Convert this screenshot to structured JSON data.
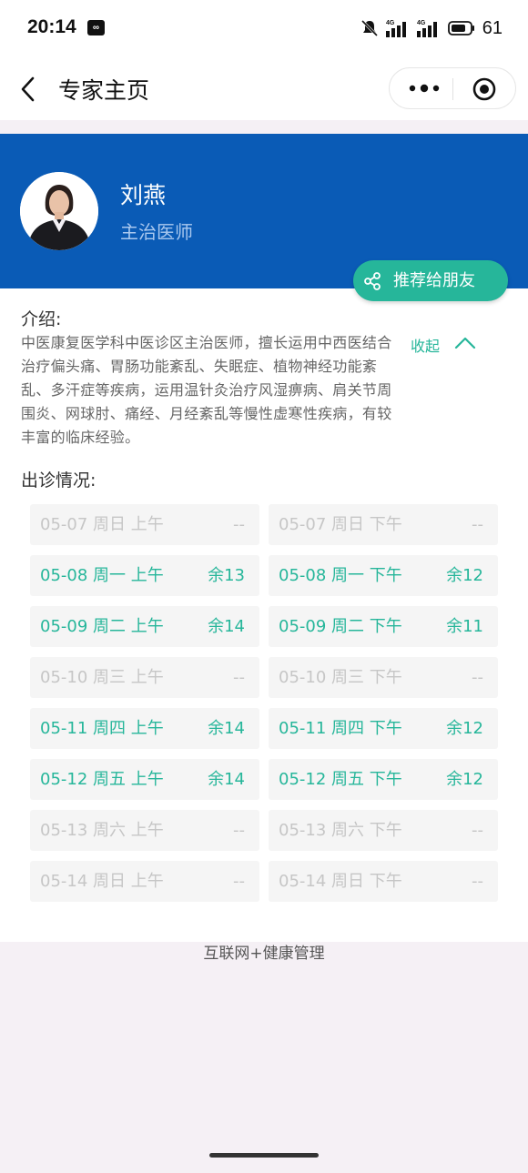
{
  "status_bar": {
    "time": "20:14",
    "battery": "61",
    "icons": [
      "app-notification-icon",
      "mute-icon",
      "signal-4g-icon",
      "signal-4g-icon",
      "battery-icon"
    ]
  },
  "nav": {
    "back_icon": "back-chevron-icon",
    "title": "专家主页",
    "capsule_icons": [
      "more-dots-icon",
      "target-icon"
    ]
  },
  "doctor": {
    "name": "刘燕",
    "title": "主治医师"
  },
  "share": {
    "label": "推荐给朋友",
    "icon": "share-icon"
  },
  "intro": {
    "label": "介绍:",
    "text": "中医康复医学科中医诊区主治医师，擅长运用中西医结合治疗偏头痛、胃肠功能紊乱、失眠症、植物神经功能紊乱、多汗症等疾病，运用温针灸治疗风湿痹病、肩关节周围炎、网球肘、痛经、月经紊乱等慢性虚寒性疾病，有较丰富的临床经验。",
    "collapse_label": "收起"
  },
  "schedule": {
    "label": "出诊情况:",
    "rows": [
      {
        "am": {
          "date": "05-07 周日 上午",
          "avail": "--",
          "open": false
        },
        "pm": {
          "date": "05-07 周日 下午",
          "avail": "--",
          "open": false
        }
      },
      {
        "am": {
          "date": "05-08 周一 上午",
          "avail": "余13",
          "open": true
        },
        "pm": {
          "date": "05-08 周一 下午",
          "avail": "余12",
          "open": true
        }
      },
      {
        "am": {
          "date": "05-09 周二 上午",
          "avail": "余14",
          "open": true
        },
        "pm": {
          "date": "05-09 周二 下午",
          "avail": "余11",
          "open": true
        }
      },
      {
        "am": {
          "date": "05-10 周三 上午",
          "avail": "--",
          "open": false
        },
        "pm": {
          "date": "05-10 周三 下午",
          "avail": "--",
          "open": false
        }
      },
      {
        "am": {
          "date": "05-11 周四 上午",
          "avail": "余14",
          "open": true
        },
        "pm": {
          "date": "05-11 周四 下午",
          "avail": "余12",
          "open": true
        }
      },
      {
        "am": {
          "date": "05-12 周五 上午",
          "avail": "余14",
          "open": true
        },
        "pm": {
          "date": "05-12 周五 下午",
          "avail": "余12",
          "open": true
        }
      },
      {
        "am": {
          "date": "05-13 周六 上午",
          "avail": "--",
          "open": false
        },
        "pm": {
          "date": "05-13 周六 下午",
          "avail": "--",
          "open": false
        }
      },
      {
        "am": {
          "date": "05-14 周日 上午",
          "avail": "--",
          "open": false
        },
        "pm": {
          "date": "05-14 周日 下午",
          "avail": "--",
          "open": false
        }
      }
    ]
  },
  "footer": {
    "text": "互联网+健康管理"
  },
  "colors": {
    "brand_blue": "#0a5bb6",
    "accent_green": "#26b69a",
    "disabled_text": "#c6c6c6"
  }
}
